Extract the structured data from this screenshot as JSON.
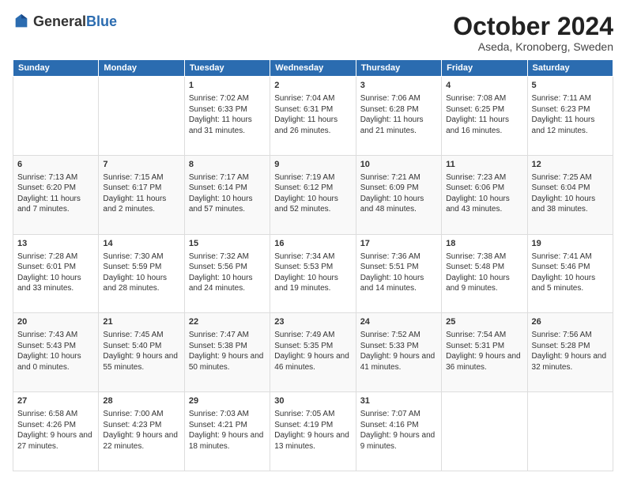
{
  "header": {
    "logo_general": "General",
    "logo_blue": "Blue",
    "month_title": "October 2024",
    "location": "Aseda, Kronoberg, Sweden"
  },
  "days_of_week": [
    "Sunday",
    "Monday",
    "Tuesday",
    "Wednesday",
    "Thursday",
    "Friday",
    "Saturday"
  ],
  "weeks": [
    [
      {
        "day": "",
        "content": ""
      },
      {
        "day": "",
        "content": ""
      },
      {
        "day": "1",
        "content": "Sunrise: 7:02 AM\nSunset: 6:33 PM\nDaylight: 11 hours and 31 minutes."
      },
      {
        "day": "2",
        "content": "Sunrise: 7:04 AM\nSunset: 6:31 PM\nDaylight: 11 hours and 26 minutes."
      },
      {
        "day": "3",
        "content": "Sunrise: 7:06 AM\nSunset: 6:28 PM\nDaylight: 11 hours and 21 minutes."
      },
      {
        "day": "4",
        "content": "Sunrise: 7:08 AM\nSunset: 6:25 PM\nDaylight: 11 hours and 16 minutes."
      },
      {
        "day": "5",
        "content": "Sunrise: 7:11 AM\nSunset: 6:23 PM\nDaylight: 11 hours and 12 minutes."
      }
    ],
    [
      {
        "day": "6",
        "content": "Sunrise: 7:13 AM\nSunset: 6:20 PM\nDaylight: 11 hours and 7 minutes."
      },
      {
        "day": "7",
        "content": "Sunrise: 7:15 AM\nSunset: 6:17 PM\nDaylight: 11 hours and 2 minutes."
      },
      {
        "day": "8",
        "content": "Sunrise: 7:17 AM\nSunset: 6:14 PM\nDaylight: 10 hours and 57 minutes."
      },
      {
        "day": "9",
        "content": "Sunrise: 7:19 AM\nSunset: 6:12 PM\nDaylight: 10 hours and 52 minutes."
      },
      {
        "day": "10",
        "content": "Sunrise: 7:21 AM\nSunset: 6:09 PM\nDaylight: 10 hours and 48 minutes."
      },
      {
        "day": "11",
        "content": "Sunrise: 7:23 AM\nSunset: 6:06 PM\nDaylight: 10 hours and 43 minutes."
      },
      {
        "day": "12",
        "content": "Sunrise: 7:25 AM\nSunset: 6:04 PM\nDaylight: 10 hours and 38 minutes."
      }
    ],
    [
      {
        "day": "13",
        "content": "Sunrise: 7:28 AM\nSunset: 6:01 PM\nDaylight: 10 hours and 33 minutes."
      },
      {
        "day": "14",
        "content": "Sunrise: 7:30 AM\nSunset: 5:59 PM\nDaylight: 10 hours and 28 minutes."
      },
      {
        "day": "15",
        "content": "Sunrise: 7:32 AM\nSunset: 5:56 PM\nDaylight: 10 hours and 24 minutes."
      },
      {
        "day": "16",
        "content": "Sunrise: 7:34 AM\nSunset: 5:53 PM\nDaylight: 10 hours and 19 minutes."
      },
      {
        "day": "17",
        "content": "Sunrise: 7:36 AM\nSunset: 5:51 PM\nDaylight: 10 hours and 14 minutes."
      },
      {
        "day": "18",
        "content": "Sunrise: 7:38 AM\nSunset: 5:48 PM\nDaylight: 10 hours and 9 minutes."
      },
      {
        "day": "19",
        "content": "Sunrise: 7:41 AM\nSunset: 5:46 PM\nDaylight: 10 hours and 5 minutes."
      }
    ],
    [
      {
        "day": "20",
        "content": "Sunrise: 7:43 AM\nSunset: 5:43 PM\nDaylight: 10 hours and 0 minutes."
      },
      {
        "day": "21",
        "content": "Sunrise: 7:45 AM\nSunset: 5:40 PM\nDaylight: 9 hours and 55 minutes."
      },
      {
        "day": "22",
        "content": "Sunrise: 7:47 AM\nSunset: 5:38 PM\nDaylight: 9 hours and 50 minutes."
      },
      {
        "day": "23",
        "content": "Sunrise: 7:49 AM\nSunset: 5:35 PM\nDaylight: 9 hours and 46 minutes."
      },
      {
        "day": "24",
        "content": "Sunrise: 7:52 AM\nSunset: 5:33 PM\nDaylight: 9 hours and 41 minutes."
      },
      {
        "day": "25",
        "content": "Sunrise: 7:54 AM\nSunset: 5:31 PM\nDaylight: 9 hours and 36 minutes."
      },
      {
        "day": "26",
        "content": "Sunrise: 7:56 AM\nSunset: 5:28 PM\nDaylight: 9 hours and 32 minutes."
      }
    ],
    [
      {
        "day": "27",
        "content": "Sunrise: 6:58 AM\nSunset: 4:26 PM\nDaylight: 9 hours and 27 minutes."
      },
      {
        "day": "28",
        "content": "Sunrise: 7:00 AM\nSunset: 4:23 PM\nDaylight: 9 hours and 22 minutes."
      },
      {
        "day": "29",
        "content": "Sunrise: 7:03 AM\nSunset: 4:21 PM\nDaylight: 9 hours and 18 minutes."
      },
      {
        "day": "30",
        "content": "Sunrise: 7:05 AM\nSunset: 4:19 PM\nDaylight: 9 hours and 13 minutes."
      },
      {
        "day": "31",
        "content": "Sunrise: 7:07 AM\nSunset: 4:16 PM\nDaylight: 9 hours and 9 minutes."
      },
      {
        "day": "",
        "content": ""
      },
      {
        "day": "",
        "content": ""
      }
    ]
  ]
}
